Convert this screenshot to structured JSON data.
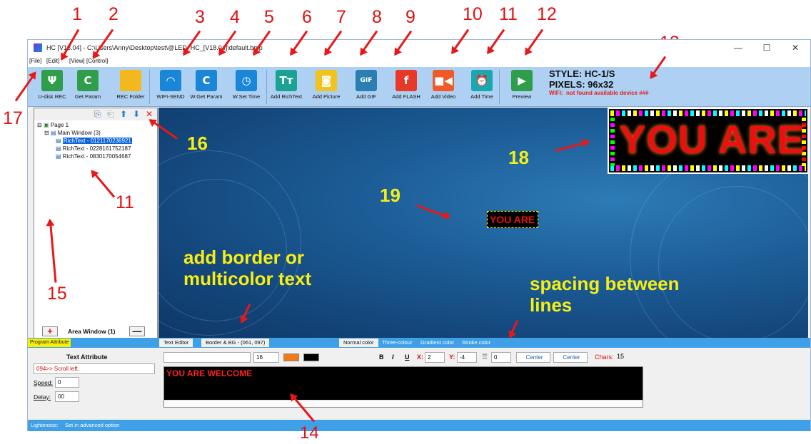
{
  "window": {
    "title": "HC [V18.04] - C:\\Users\\Anny\\Desktop\\test\\@LED_HC_[V18.04]\\default.bmp",
    "min": "—",
    "max": "☐",
    "close": "✕"
  },
  "menu": [
    "[File]",
    "[Edit]",
    "[View]",
    "[Control]"
  ],
  "toolbar": {
    "buttons": [
      {
        "label": "U-disk REC",
        "icon": "usb-icon",
        "glyph": "Ψ",
        "color": "#2e9e4a"
      },
      {
        "label": "Get Param",
        "icon": "refresh-icon",
        "glyph": "C",
        "color": "#2e9e4a"
      },
      {
        "label": "REC Folder",
        "icon": "folder-icon",
        "glyph": "",
        "color": "#f2b81e"
      },
      {
        "label": "WIFI-SEND",
        "icon": "wifi-icon",
        "glyph": "◠",
        "color": "#1a86d8"
      },
      {
        "label": "W.Get Param",
        "icon": "refresh-icon",
        "glyph": "C",
        "color": "#1a86d8"
      },
      {
        "label": "W.Set Time",
        "icon": "timer-icon",
        "glyph": "◷",
        "color": "#1a86d8"
      },
      {
        "label": "Add RichText",
        "icon": "richtext-icon",
        "glyph": "Tт",
        "color": "#1aa393"
      },
      {
        "label": "Add Picture",
        "icon": "camera-icon",
        "glyph": "◙",
        "color": "#f2c21e"
      },
      {
        "label": "Add GIF",
        "icon": "gif-icon",
        "glyph": "GIF",
        "color": "#2a7fb0"
      },
      {
        "label": "Add FLASH",
        "icon": "flash-icon",
        "glyph": "f",
        "color": "#e83828"
      },
      {
        "label": "Add Video",
        "icon": "video-icon",
        "glyph": "■◀",
        "color": "#f05a28"
      },
      {
        "label": "Add Time",
        "icon": "clock-icon",
        "glyph": "⏰",
        "color": "#1aa8b0"
      },
      {
        "label": "Preview",
        "icon": "play-icon",
        "glyph": "▶",
        "color": "#2e9e4a"
      }
    ],
    "style": "STYLE: HC-1/S",
    "pixels": "PIXELS: 96x32",
    "wifi_label": "WIFI:",
    "wifi_status": "not found available device ###"
  },
  "tree": {
    "page": "Page 1",
    "window": "Main Window  (3)",
    "items": [
      "RichText - 0121170236921",
      "RichText - 0228161752187",
      "RichText - 0830170054687"
    ]
  },
  "area_bar": {
    "label": "Area Window (1)",
    "plus": "+",
    "minus": "—"
  },
  "tabs": {
    "program": "Program Attribute",
    "editor": "Text Editor",
    "border": "Border & BG - (061, 097)",
    "colors": [
      "Normal color",
      "Three-colour",
      "Gradient color",
      "Stroke color"
    ]
  },
  "text_attribute": {
    "heading": "Text Attribute",
    "effect": "094>> Scroll left.",
    "speed_label": "Speed:",
    "speed": "0",
    "delay_label": "Delay:",
    "delay": "00"
  },
  "format": {
    "font_size": "16",
    "bold": "B",
    "italic": "I",
    "underline": "U",
    "x_label": "X:",
    "x": "2",
    "y_label": "Y:",
    "y": "-4",
    "spacing": "0",
    "center1": "Center",
    "center2": "Center",
    "chars_label": "Chars:",
    "chars": "15"
  },
  "editor_text": "YOU ARE WELCOME",
  "preview_text": "YOU ARE",
  "mini_text": "YOU ARE",
  "status": {
    "lightness": "Lighteness:",
    "value": "Set in advanced option"
  },
  "annotations": {
    "numbers": [
      "1",
      "2",
      "3",
      "4",
      "5",
      "6",
      "7",
      "8",
      "9",
      "10",
      "11",
      "12",
      "13",
      "14",
      "15",
      "16",
      "17",
      "18",
      "19",
      "11"
    ],
    "notes": [
      "add border or",
      "multicolor text",
      "spacing between",
      "lines"
    ]
  }
}
